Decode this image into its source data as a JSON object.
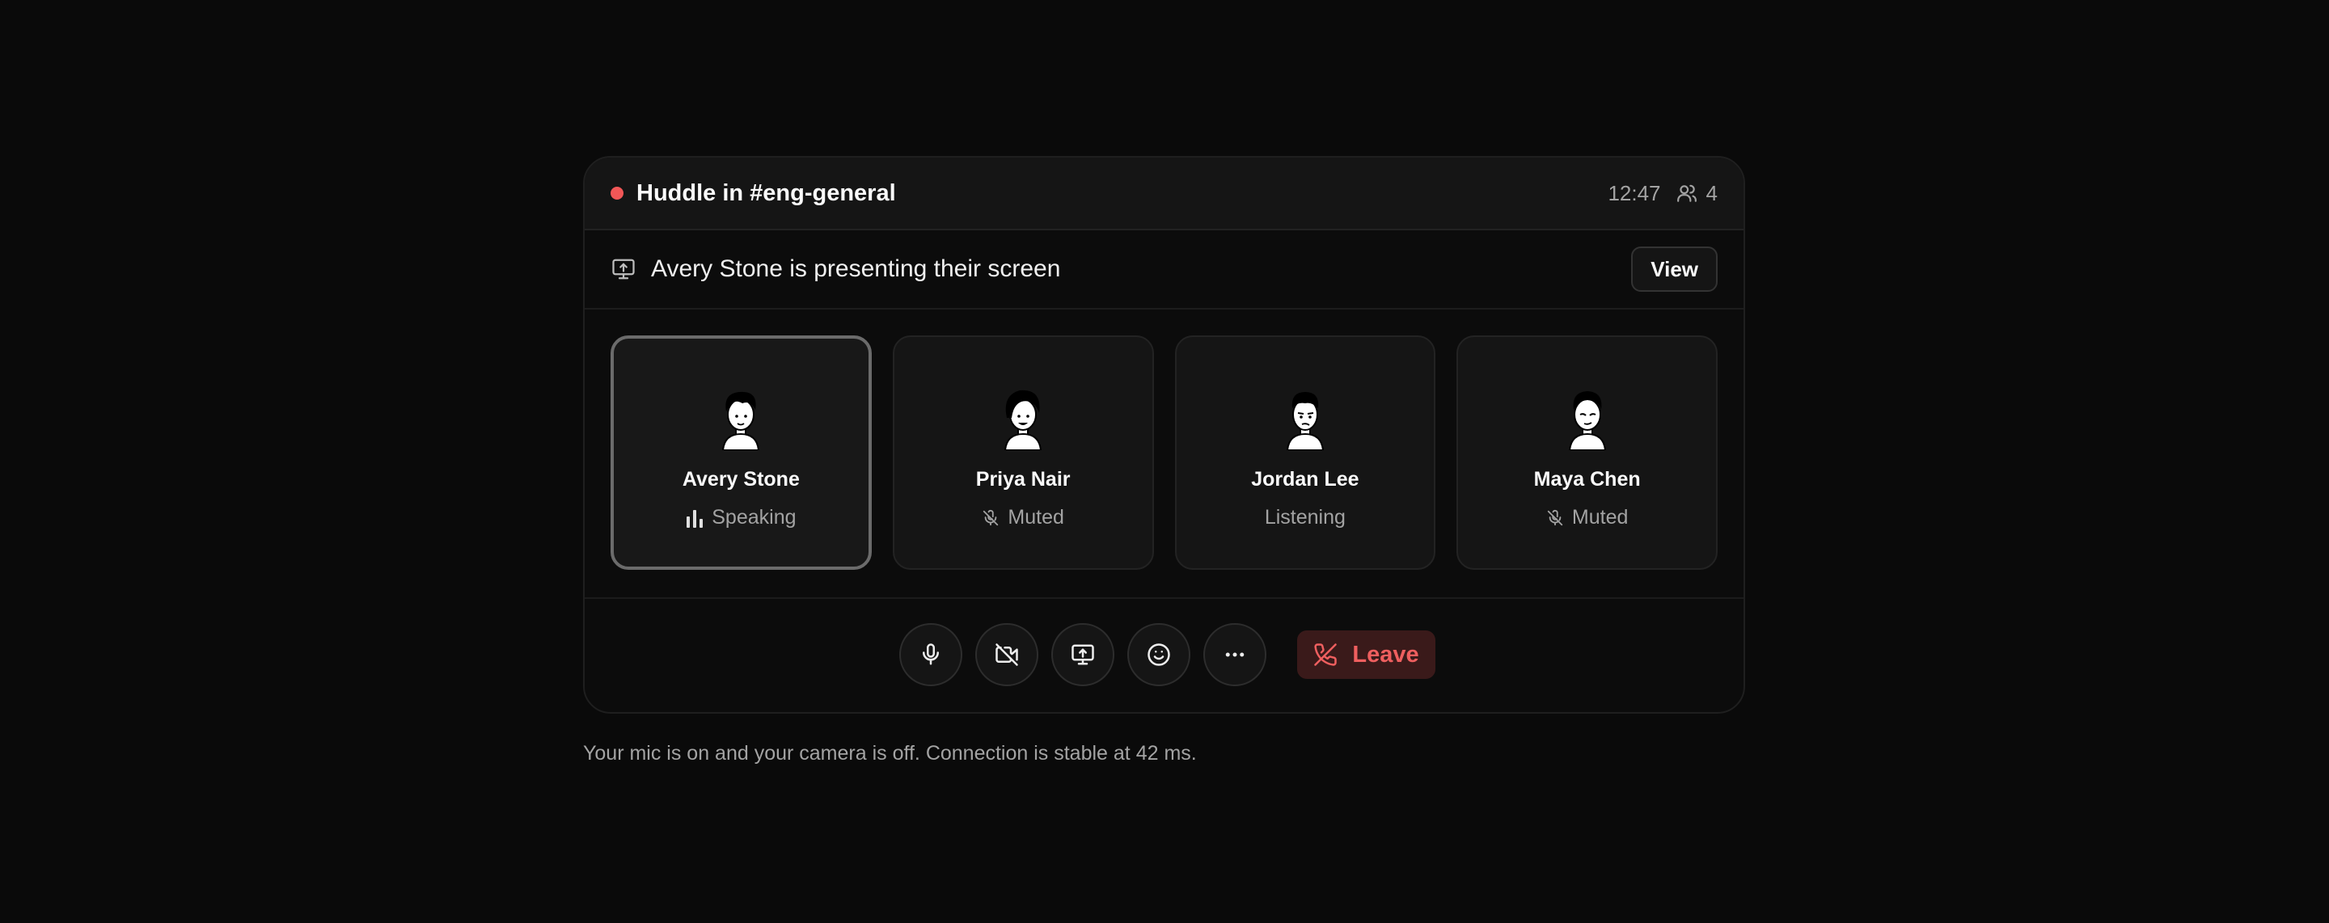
{
  "header": {
    "title": "Huddle in #eng-general",
    "time": "12:47",
    "participant_count": "4",
    "live_color": "#f25757"
  },
  "banner": {
    "text": "Avery Stone is presenting their screen",
    "view_label": "View",
    "icon": "screen-share-icon"
  },
  "participants": [
    {
      "name": "Avery Stone",
      "status": "Speaking",
      "status_icon": "audio-bars-icon",
      "active": true
    },
    {
      "name": "Priya Nair",
      "status": "Muted",
      "status_icon": "mic-off-icon",
      "active": false
    },
    {
      "name": "Jordan Lee",
      "status": "Listening",
      "status_icon": "",
      "active": false
    },
    {
      "name": "Maya Chen",
      "status": "Muted",
      "status_icon": "mic-off-icon",
      "active": false
    }
  ],
  "controls": {
    "icons": [
      "mic-icon",
      "camera-off-icon",
      "screen-share-icon",
      "emoji-icon",
      "more-icon"
    ],
    "leave_label": "Leave",
    "leave_color": "#ef5f5f"
  },
  "footer": {
    "note": "Your mic is on and your camera is off. Connection is stable at 42 ms."
  }
}
